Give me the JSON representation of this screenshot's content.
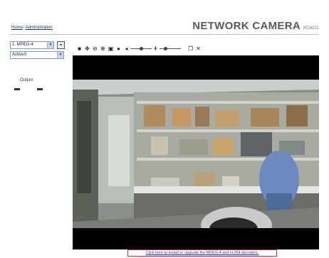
{
  "header": {
    "home_link": "Home",
    "separator": "|",
    "admin_link": "Administration",
    "product_title": "NETWORK CAMERA",
    "model": "RC8221"
  },
  "controls": {
    "stream_select": "1. MPEG-4",
    "viewer_select": "ActiveX",
    "output_label": "Output"
  },
  "toolbar": {
    "icons": [
      "stop-icon",
      "pan-icon",
      "zoom-out-icon",
      "zoom-in-icon",
      "snapshot-icon",
      "record-icon",
      "speaker-icon",
      "volume-slider",
      "mic-icon",
      "mic-volume-slider",
      "fullscreen-icon",
      "settings-icon"
    ],
    "volume_level": 0.5,
    "mic_level": 0.25
  },
  "video": {
    "scene": "lab-room-live-view"
  },
  "footer": {
    "decoder_link": "Click here to install or upgrade the MPEG-4 and H.264 decoders."
  },
  "colors": {
    "link": "#1a2a80",
    "decoder_border": "#e02020",
    "title_gray": "#5a5a5a"
  }
}
